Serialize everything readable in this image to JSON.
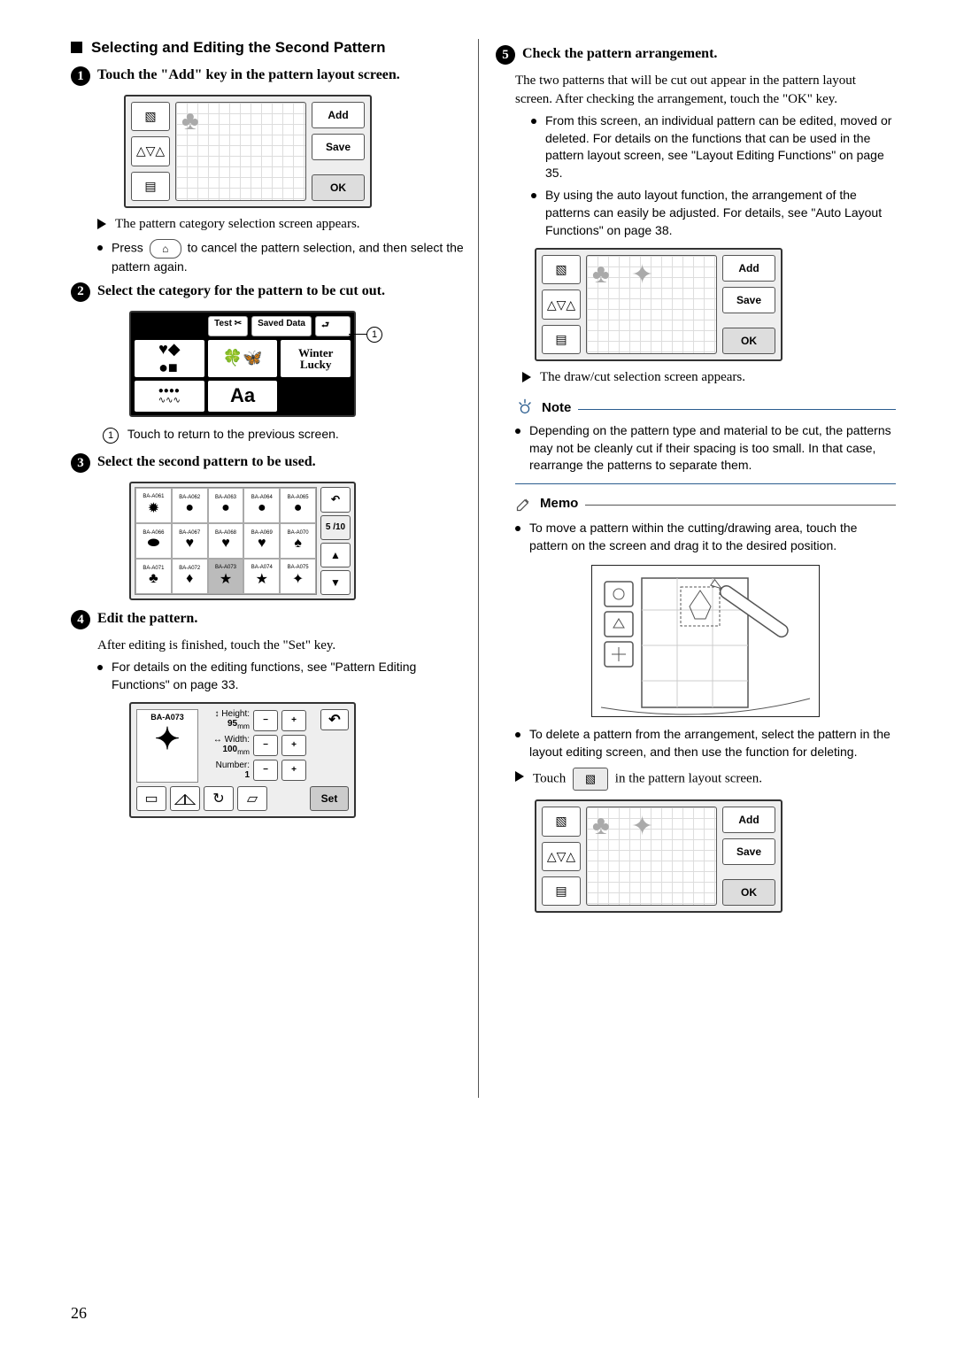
{
  "page_number": "26",
  "left": {
    "section_title": "Selecting and Editing the Second Pattern",
    "step1": {
      "title": "Touch the \"Add\" key in the pattern layout screen.",
      "screen": {
        "add": "Add",
        "save": "Save",
        "ok": "OK"
      },
      "bullet1": "The pattern category selection screen appears.",
      "bullet2_a": "Press",
      "bullet2_b": "to cancel the pattern selection, and then select the pattern again."
    },
    "step2": {
      "title": "Select the category for the pattern to be cut out.",
      "screen": {
        "test": "Test ✂",
        "saved": "Saved Data",
        "winter": "Winter",
        "lucky": "Lucky",
        "aa": "Aa"
      },
      "callout1": "Touch to return to the previous screen."
    },
    "step3": {
      "title": "Select the second pattern to be used.",
      "screen": {
        "ids": [
          "BA-A061",
          "BA-A062",
          "BA-A063",
          "BA-A064",
          "BA-A065",
          "BA-A066",
          "BA-A067",
          "BA-A068",
          "BA-A069",
          "BA-A070",
          "BA-A071",
          "BA-A072",
          "BA-A073",
          "BA-A074",
          "BA-A075"
        ],
        "page": "5 /10"
      }
    },
    "step4": {
      "title": "Edit the pattern.",
      "after": "After editing is finished, touch the \"Set\" key.",
      "bullet": "For details on the editing functions, see \"Pattern Editing Functions\" on page 33.",
      "screen": {
        "id": "BA-A073",
        "height_lbl": "↕ Height:",
        "height_val": "95",
        "height_unit": "mm",
        "width_lbl": "↔ Width:",
        "width_val": "100",
        "width_unit": "mm",
        "number_lbl": "Number:",
        "number_val": "1",
        "set": "Set"
      }
    }
  },
  "right": {
    "step5": {
      "title": "Check the pattern arrangement.",
      "intro": "The two patterns that will be cut out appear in the pattern layout screen. After checking the arrangement, touch the \"OK\" key.",
      "b1": "From this screen, an individual pattern can be edited, moved or deleted. For details on the functions that can be used in the pattern layout screen, see \"Layout Editing Functions\" on page 35.",
      "b2": "By using the auto layout function, the arrangement of the patterns can easily be adjusted. For details, see \"Auto Layout Functions\" on page 38.",
      "screen": {
        "add": "Add",
        "save": "Save",
        "ok": "OK"
      },
      "next": "The draw/cut selection screen appears."
    },
    "note": {
      "label": "Note",
      "text": "Depending on the pattern type and material to be cut, the patterns may not be cleanly cut if their spacing is too small. In that case, rearrange the patterns to separate them."
    },
    "memo": {
      "label": "Memo",
      "m1": "To move a pattern within the cutting/drawing area, touch the pattern on the screen and drag it to the desired position.",
      "m2": "To delete a pattern from the arrangement, select the pattern in the layout editing screen, and then use the function for deleting.",
      "touch_a": "Touch",
      "touch_b": "in the pattern layout screen.",
      "screen": {
        "add": "Add",
        "save": "Save",
        "ok": "OK"
      }
    }
  }
}
